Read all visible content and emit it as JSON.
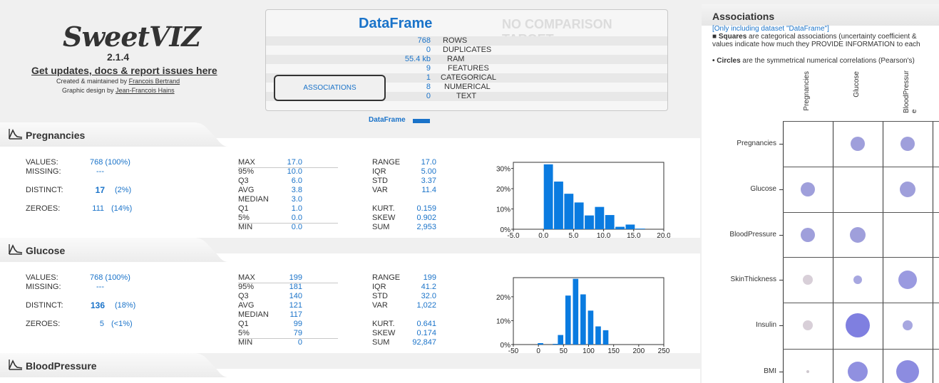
{
  "logo": {
    "name": "SweetVIZ",
    "version": "2.1.4",
    "updates": "Get updates, docs & report issues here",
    "created": "Created & maintained by",
    "created_by": "Francois Bertrand",
    "design": "Graphic design by",
    "design_by": "Jean-Francois Hains"
  },
  "summary": {
    "dataset_name": "DataFrame",
    "comparison": "NO COMPARISON TARGET",
    "rows": [
      {
        "value": "768",
        "label": "ROWS"
      },
      {
        "value": "0",
        "label": "DUPLICATES"
      },
      {
        "value": "55.4 kb",
        "label": "RAM"
      },
      {
        "value": "9",
        "label": "FEATURES"
      },
      {
        "value": "1",
        "label": "CATEGORICAL"
      },
      {
        "value": "8",
        "label": "NUMERICAL"
      },
      {
        "value": "0",
        "label": "TEXT"
      }
    ],
    "associations_button": "ASSOCIATIONS",
    "legend": "DataFrame",
    "legend_color": "#1a73c9"
  },
  "features": [
    {
      "name": "Pregnancies",
      "values_label": "VALUES:",
      "values": "768 (100%)",
      "missing_label": "MISSING:",
      "missing": "---",
      "distinct_label": "DISTINCT:",
      "distinct": "17",
      "distinct_pct": "(2%)",
      "zeroes_label": "ZEROES:",
      "zeroes": "111",
      "zeroes_pct": "(14%)",
      "quantiles": [
        [
          "MAX",
          "17.0"
        ],
        [
          "95%",
          "10.0"
        ],
        [
          "Q3",
          "6.0"
        ],
        [
          "AVG",
          "3.8"
        ],
        [
          "MEDIAN",
          "3.0"
        ],
        [
          "Q1",
          "1.0"
        ],
        [
          "5%",
          "0.0"
        ],
        [
          "MIN",
          "0.0"
        ]
      ],
      "stats1": [
        [
          "RANGE",
          "17.0"
        ],
        [
          "IQR",
          "5.00"
        ],
        [
          "STD",
          "3.37"
        ],
        [
          "VAR",
          "11.4"
        ]
      ],
      "stats2": [
        [
          "KURT.",
          "0.159"
        ],
        [
          "SKEW",
          "0.902"
        ],
        [
          "SUM",
          "2,953"
        ]
      ]
    },
    {
      "name": "Glucose",
      "values_label": "VALUES:",
      "values": "768 (100%)",
      "missing_label": "MISSING:",
      "missing": "---",
      "distinct_label": "DISTINCT:",
      "distinct": "136",
      "distinct_pct": "(18%)",
      "zeroes_label": "ZEROES:",
      "zeroes": "5",
      "zeroes_pct": "(<1%)",
      "quantiles": [
        [
          "MAX",
          "199"
        ],
        [
          "95%",
          "181"
        ],
        [
          "Q3",
          "140"
        ],
        [
          "AVG",
          "121"
        ],
        [
          "MEDIAN",
          "117"
        ],
        [
          "Q1",
          "99"
        ],
        [
          "5%",
          "79"
        ],
        [
          "MIN",
          "0"
        ]
      ],
      "stats1": [
        [
          "RANGE",
          "199"
        ],
        [
          "IQR",
          "41.2"
        ],
        [
          "STD",
          "32.0"
        ],
        [
          "VAR",
          "1,022"
        ]
      ],
      "stats2": [
        [
          "KURT.",
          "0.641"
        ],
        [
          "SKEW",
          "0.174"
        ],
        [
          "SUM",
          "92,847"
        ]
      ]
    },
    {
      "name": "BloodPressure"
    }
  ],
  "chart_data": [
    {
      "type": "bar",
      "xlim": [
        -5.0,
        20.0
      ],
      "ylim": [
        0,
        33
      ],
      "x_ticks": [
        "-5.0",
        "0.0",
        "5.0",
        "10.0",
        "15.0",
        "20.0"
      ],
      "y_ticks": [
        "0%",
        "10%",
        "20%",
        "30%"
      ],
      "bin_start": 0.0,
      "bin_width": 1.7,
      "values": [
        32.0,
        23.5,
        17.5,
        13.2,
        6.8,
        11.0,
        7.0,
        1.2,
        2.3,
        0.3
      ],
      "color": "#0a7be0"
    },
    {
      "type": "bar",
      "xlim": [
        -50,
        250
      ],
      "ylim": [
        0,
        28
      ],
      "x_ticks": [
        "-50",
        "0",
        "50",
        "100",
        "150",
        "200",
        "250"
      ],
      "y_ticks": [
        "0%",
        "10%",
        "20%"
      ],
      "bin_start": 0,
      "bin_width": 10,
      "values": [
        0.6,
        0,
        0,
        0.3,
        4.0,
        20.5,
        27.5,
        21.0,
        14.2,
        7.6,
        6.0
      ],
      "bin_starts": [
        0,
        10,
        20,
        30,
        40,
        60,
        90,
        110,
        120,
        140,
        160,
        180
      ],
      "color": "#0a7be0"
    }
  ],
  "associations": {
    "title": "Associations",
    "note1": "[Only including dataset \"DataFrame\"]",
    "note2a": "■ Squares",
    "note2b": " are categorical associations (uncertainty coefficient &",
    "note3": "values indicate how much they PROVIDE INFORMATION to each",
    "note4a": "• Circles",
    "note4b": " are the symmetrical numerical correlations (Pearson's)",
    "columns": [
      "Pregnancies",
      "Glucose",
      "BloodPressure"
    ],
    "rows": [
      "Pregnancies",
      "Glucose",
      "BloodPressure",
      "SkinThickness",
      "Insulin",
      "BMI"
    ],
    "cells": [
      [
        null,
        {
          "r": 10,
          "c": "#9f9fdb"
        },
        {
          "r": 10,
          "c": "#9f9fdb"
        }
      ],
      [
        {
          "r": 10,
          "c": "#9f9fdb"
        },
        null,
        {
          "r": 11,
          "c": "#9f9fdb"
        }
      ],
      [
        {
          "r": 10,
          "c": "#9f9fdb"
        },
        {
          "r": 11,
          "c": "#9f9fdb"
        },
        null
      ],
      [
        {
          "r": 7,
          "c": "#d8cfd8"
        },
        {
          "r": 6,
          "c": "#a7a7e0"
        },
        {
          "r": 13,
          "c": "#9a9ae0"
        }
      ],
      [
        {
          "r": 7,
          "c": "#d8cfd8"
        },
        {
          "r": 17,
          "c": "#7f7fe0"
        },
        {
          "r": 7,
          "c": "#a7a7e0"
        }
      ],
      [
        {
          "r": 2,
          "c": "#cfc8cf"
        },
        {
          "r": 14,
          "c": "#9090e0"
        },
        {
          "r": 16,
          "c": "#8c8ce0"
        }
      ]
    ]
  }
}
